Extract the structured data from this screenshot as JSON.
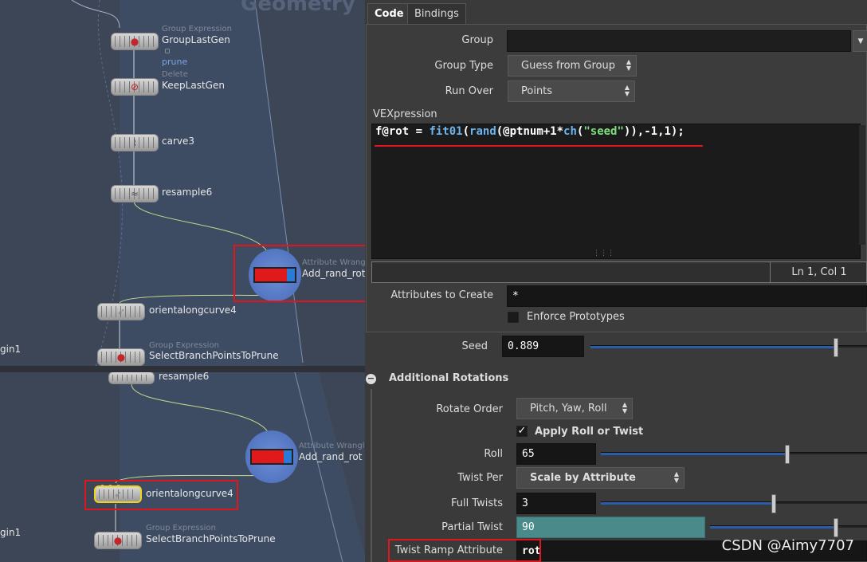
{
  "network": {
    "title_ghost": "Geometry",
    "top": {
      "nodes": [
        {
          "type": "Group Expression",
          "name": "GroupLastGen",
          "icon": "group-expression-icon"
        },
        {
          "type": "Delete",
          "name": "KeepLastGen",
          "icon": "delete-icon"
        },
        {
          "type": "",
          "name": "carve3",
          "icon": "carve-icon"
        },
        {
          "type": "",
          "name": "resample6",
          "icon": "resample-icon"
        },
        {
          "type": "Attribute Wrangle",
          "name": "Add_rand_rot",
          "icon": "attribute-wrangle-icon"
        },
        {
          "type": "",
          "name": "orientalongcurve4",
          "icon": "orient-along-curve-icon"
        },
        {
          "type": "Group Expression",
          "name": "SelectBranchPointsToPrune",
          "icon": "group-expression-icon"
        }
      ],
      "prune_label": "prune",
      "edge_label": "gin1"
    },
    "bottom": {
      "nodes": [
        {
          "type": "",
          "name": "resample6"
        },
        {
          "type": "Attribute Wrangle",
          "name": "Add_rand_rot"
        },
        {
          "type": "",
          "name": "orientalongcurve4"
        },
        {
          "type": "Group Expression",
          "name": "SelectBranchPointsToPrune"
        }
      ],
      "edge_label": "gin1"
    }
  },
  "tabs": [
    {
      "label": "Code",
      "active": true
    },
    {
      "label": "Bindings",
      "active": false
    }
  ],
  "code_panel": {
    "group_label": "Group",
    "group_value": "",
    "group_type_label": "Group Type",
    "group_type_value": "Guess from Group",
    "run_over_label": "Run Over",
    "run_over_value": "Points",
    "vex_label": "VEXpression",
    "vex_tokens": [
      {
        "t": "f@rot = ",
        "c": "w"
      },
      {
        "t": "fit01",
        "c": "f"
      },
      {
        "t": "(",
        "c": "w"
      },
      {
        "t": "rand",
        "c": "f"
      },
      {
        "t": "(@ptnum+1*",
        "c": "w"
      },
      {
        "t": "ch",
        "c": "f"
      },
      {
        "t": "(",
        "c": "w"
      },
      {
        "t": "\"seed\"",
        "c": "s"
      },
      {
        "t": ")),-1,1);",
        "c": "w"
      }
    ],
    "status": "Ln 1, Col 1",
    "attrs_create_label": "Attributes to Create",
    "attrs_create_value": "*",
    "enforce_label": "Enforce Prototypes",
    "enforce_checked": false
  },
  "seed": {
    "label": "Seed",
    "value": "0.889",
    "fraction": 0.889
  },
  "rotations": {
    "section_title": "Additional Rotations",
    "rotate_order_label": "Rotate Order",
    "rotate_order_value": "Pitch, Yaw, Roll",
    "apply_label": "Apply Roll or Twist",
    "apply_checked": true,
    "roll_label": "Roll",
    "roll_value": "65",
    "roll_fraction": 0.7,
    "twist_per_label": "Twist Per",
    "twist_per_value": "Scale by Attribute",
    "full_twists_label": "Full Twists",
    "full_twists_value": "3",
    "full_twists_fraction": 0.65,
    "partial_twist_label": "Partial Twist",
    "partial_twist_value": "90",
    "partial_twist_fraction": 0.8,
    "twist_ramp_label": "Twist Ramp Attribute",
    "twist_ramp_value": "rot"
  },
  "watermark": "CSDN @Aimy7707",
  "colors": {
    "highlight_red": "#e0161c",
    "selected_yellow": "#f2d21a",
    "partial_twist_teal": "#4b8a8a"
  }
}
